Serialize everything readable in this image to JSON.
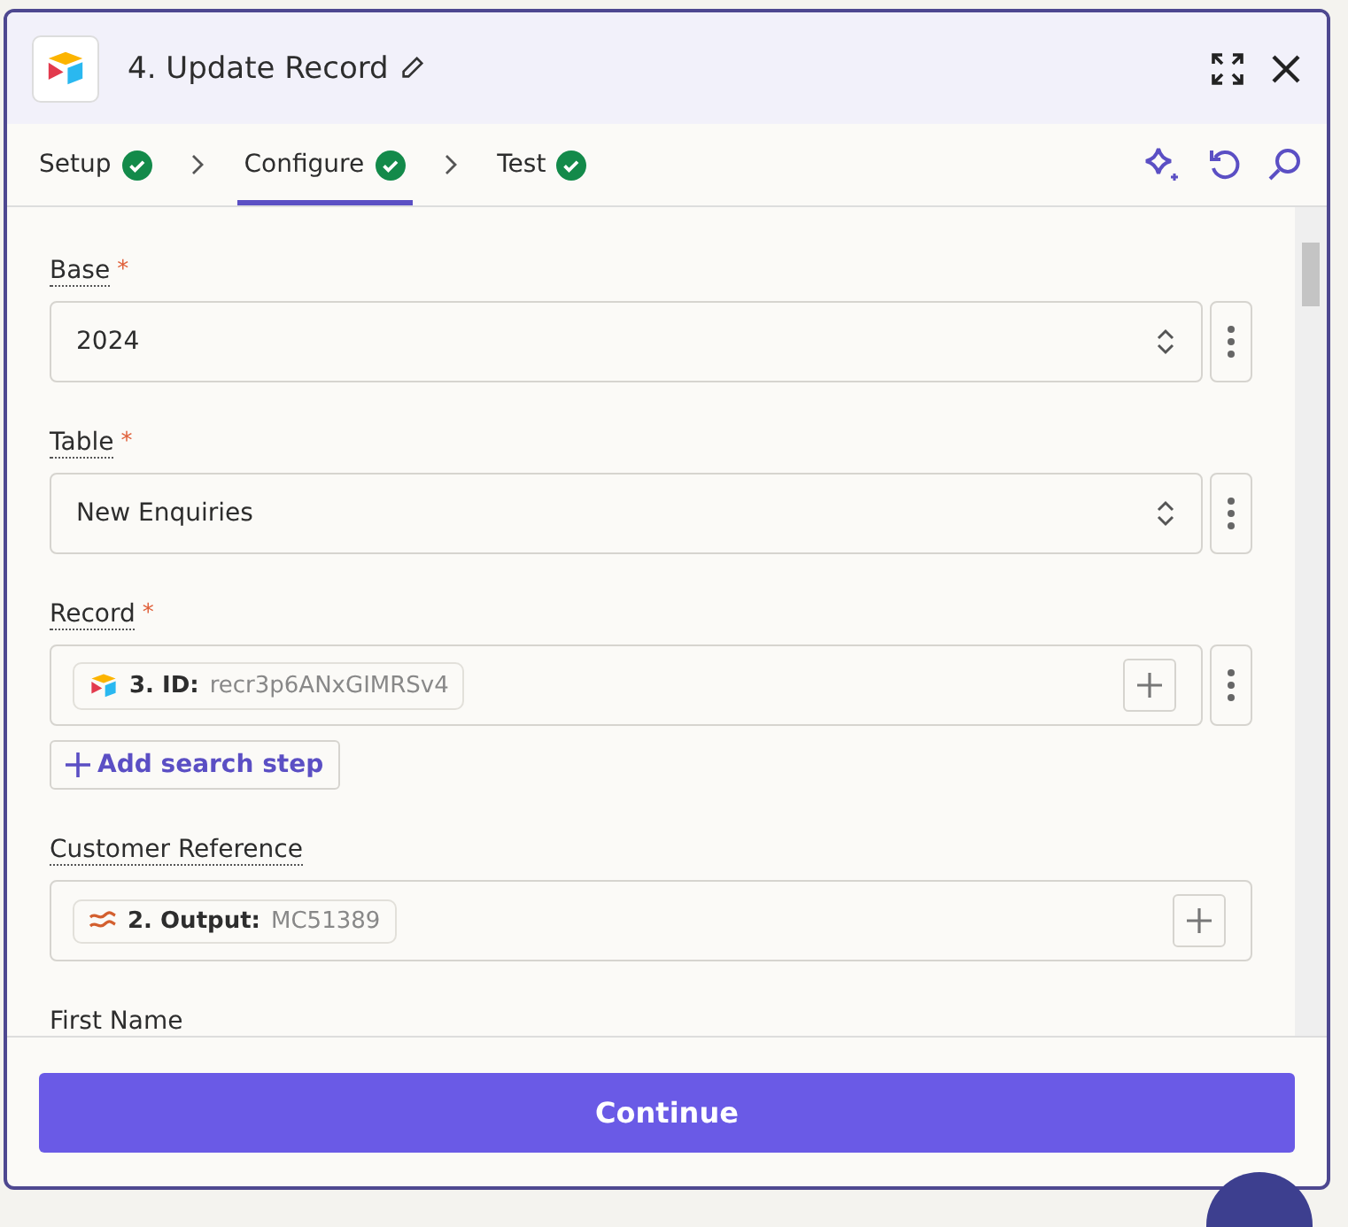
{
  "header": {
    "title": "4. Update Record"
  },
  "tabs": [
    {
      "label": "Setup",
      "done": true,
      "selected": false
    },
    {
      "label": "Configure",
      "done": true,
      "selected": true
    },
    {
      "label": "Test",
      "done": true,
      "selected": false
    }
  ],
  "fields": [
    {
      "kind": "select",
      "label": "Base",
      "required_mark": "*",
      "value": "2024",
      "menu": true
    },
    {
      "kind": "select",
      "label": "Table",
      "required_mark": "*",
      "value": "New Enquiries",
      "menu": true
    },
    {
      "kind": "mapped",
      "label": "Record",
      "required_mark": "*",
      "pill": {
        "kind": "app",
        "step": "3. ID:",
        "value": "recr3p6ANxGIMRSv4"
      },
      "menu": true,
      "action": "Add search step"
    },
    {
      "kind": "mapped",
      "label": "Customer Reference",
      "pill": {
        "kind": "formatter",
        "step": "2. Output:",
        "value": "MC51389"
      },
      "menu": false
    },
    {
      "kind": "label",
      "label": "First Name"
    }
  ],
  "footer": {
    "button": "Continue"
  }
}
